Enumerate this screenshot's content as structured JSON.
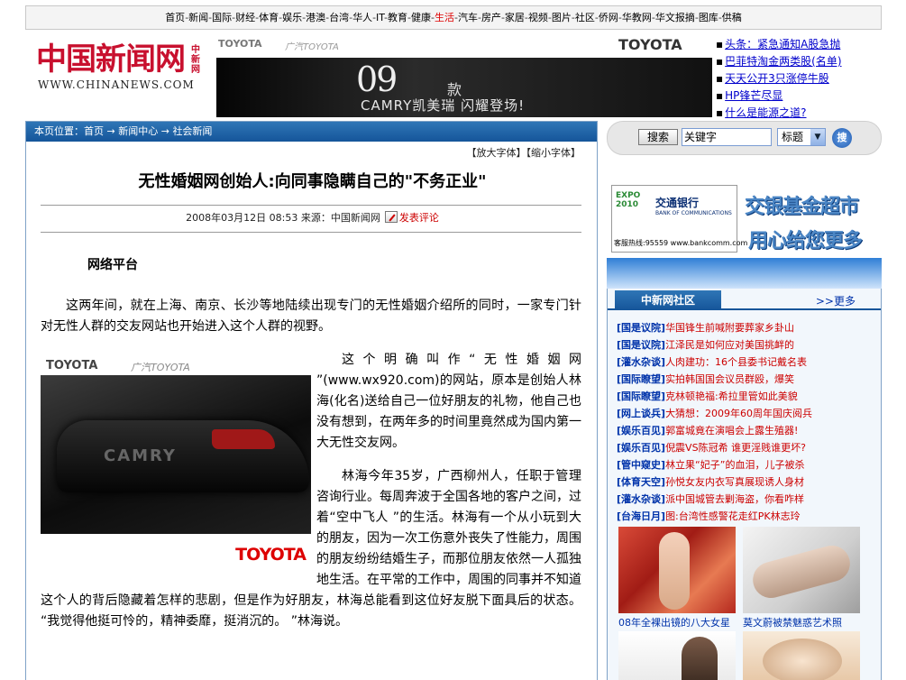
{
  "nav": {
    "items": [
      "首页",
      "新闻",
      "国际",
      "财经",
      "体育",
      "娱乐",
      "港澳",
      "台湾",
      "华人",
      "IT",
      "教育",
      "健康",
      "生活",
      "汽车",
      "房产",
      "家居",
      "视频",
      "图片",
      "社区",
      "侨网",
      "华教网",
      "华文报摘",
      "图库",
      "供稿"
    ],
    "active": "生活",
    "separator": "-"
  },
  "logo": {
    "chinese": "中国新闻网",
    "small": "中新网",
    "url": "WWW.CHINANEWS.COM",
    "color": "#c8102e"
  },
  "top_ad": {
    "brand1": "TOYOTA",
    "brand2": "广汽TOYOTA",
    "brand3": "TOYOTA",
    "big": "09",
    "kuan": "款",
    "slogan": "CAMRY凯美瑞 闪耀登场!"
  },
  "headlines": [
    "头条：紧急通知A股急抛",
    "巴菲特淘金两类股(名单)",
    "天天公开3只涨停牛股",
    "HP锋芒尽显",
    "什么是能源之道?"
  ],
  "breadcrumb": {
    "prefix": "本页位置：",
    "items": [
      "首页",
      "新闻中心",
      "社会新闻"
    ],
    "arrow": "→"
  },
  "font_controls": {
    "bigger": "【放大字体】",
    "smaller": "【缩小字体】"
  },
  "article": {
    "title": "无性婚姻网创始人:向同事隐瞒自己的\"不务正业\"",
    "date": "2008年03月12日 08:53",
    "source": "来源：中国新闻网",
    "comment": "发表评论",
    "subhead": "网络平台",
    "para1": "这两年间，就在上海、南京、长沙等地陆续出现专门的无性婚姻介绍所的同时，一家专门针对无性人群的交友网站也开始进入这个人群的视野。",
    "para2": "这个明确叫作“无性婚姻网 ”(www.wx920.com)的网站，原本是创始人林海(化名)送给自己一位好朋友的礼物，他自己也没有想到，在两年多的时间里竟然成为国内第一大无性交友网。",
    "para3": "林海今年35岁，广西柳州人，任职于管理咨询行业。每周奔波于全国各地的客户之间，过着“空中飞人 ”的生活。林海有一个从小玩到大的朋友，因为一次工伤意外丧失了性能力，周围的朋友纷纷结婚生子，而那位朋友依然一人孤独地生活。在平常的工作中，周围的同事并不知道这个人的背后隐藏着怎样的悲剧，但是作为好朋友，林海总能看到这位好友脱下面具后的状态。 “我觉得他挺可怜的，精神委靡，挺消沉的。 ”林海说。"
  },
  "car_ad": {
    "brand1": "TOYOTA",
    "brand2": "广汽TOYOTA",
    "model": "CAMRY",
    "brand3": "TOYOTA"
  },
  "search": {
    "button": "搜索",
    "keyword": "关键字",
    "field": "标题",
    "go": "搜"
  },
  "bank_ad": {
    "expo": "EXPO 2010",
    "bank": "交通银行",
    "bank_en": "BANK OF COMMUNICATIONS",
    "phone": "客服热线:95559 www.bankcomm.com",
    "slogan1": "交银基金超市",
    "slogan2": "用心给您更多"
  },
  "community": {
    "title": "中新网社区",
    "more": ">>更多",
    "rows": [
      {
        "tag": "[国是议院]",
        "text": "华国锋生前喊附要葬家乡卦山"
      },
      {
        "tag": "[国是议院]",
        "text": "江泽民是如何应对美国挑衅的"
      },
      {
        "tag": "[灌水杂谈]",
        "text": "人肉建功：16个县委书记戴名表"
      },
      {
        "tag": "[国际瞭望]",
        "text": "实拍韩国国会议员群殴，爆笑"
      },
      {
        "tag": "[国际瞭望]",
        "text": "克林顿艳福:希拉里管如此美貌"
      },
      {
        "tag": "[网上谈兵]",
        "text": "大猜想：2009年60周年国庆阅兵"
      },
      {
        "tag": "[娱乐百见]",
        "text": "郭富城竟在演唱会上露生殖器!"
      },
      {
        "tag": "[娱乐百见]",
        "text": "倪震VS陈冠希 谁更淫贱谁更坏?"
      },
      {
        "tag": "[管中窥史]",
        "text": "林立果“妃子”的血泪，儿子被杀"
      },
      {
        "tag": "[体育天空]",
        "text": "孙悦女友内衣写真展现诱人身材"
      },
      {
        "tag": "[灌水杂谈]",
        "text": "派中国城管去剿海盗，你看咋样"
      },
      {
        "tag": "[台海日月]",
        "text": "图:台湾性感警花走红PK林志玲"
      }
    ]
  },
  "thumbs": {
    "cap1": "08年全裸出镜的八大女星",
    "cap2": "莫文蔚被禁魅惑艺术照"
  }
}
